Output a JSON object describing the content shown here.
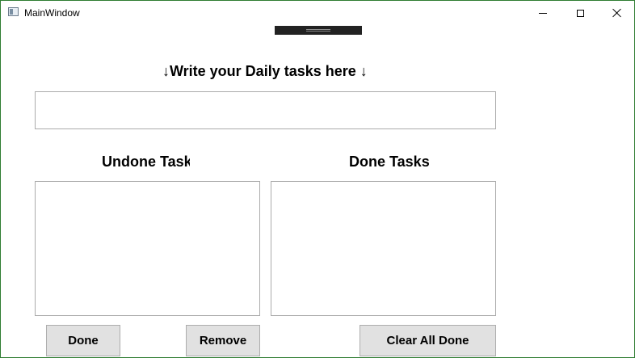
{
  "window": {
    "title": "MainWindow",
    "icon": "window-app-icon",
    "controls": [
      "minimize-icon",
      "maximize-icon",
      "close-icon"
    ]
  },
  "main": {
    "heading": "↓Write your Daily tasks here ↓",
    "task_input_value": ""
  },
  "lists": {
    "undone_heading": "Undone Tasks",
    "done_heading": "Done Tasks",
    "undone_items": [],
    "done_items": []
  },
  "buttons": {
    "done_label": "Done",
    "remove_label": "Remove",
    "clear_all_done_label": "Clear All Done"
  },
  "colors": {
    "window_border": "#2e7d32",
    "button_face": "#e1e1e1",
    "control_border": "#ababab"
  }
}
